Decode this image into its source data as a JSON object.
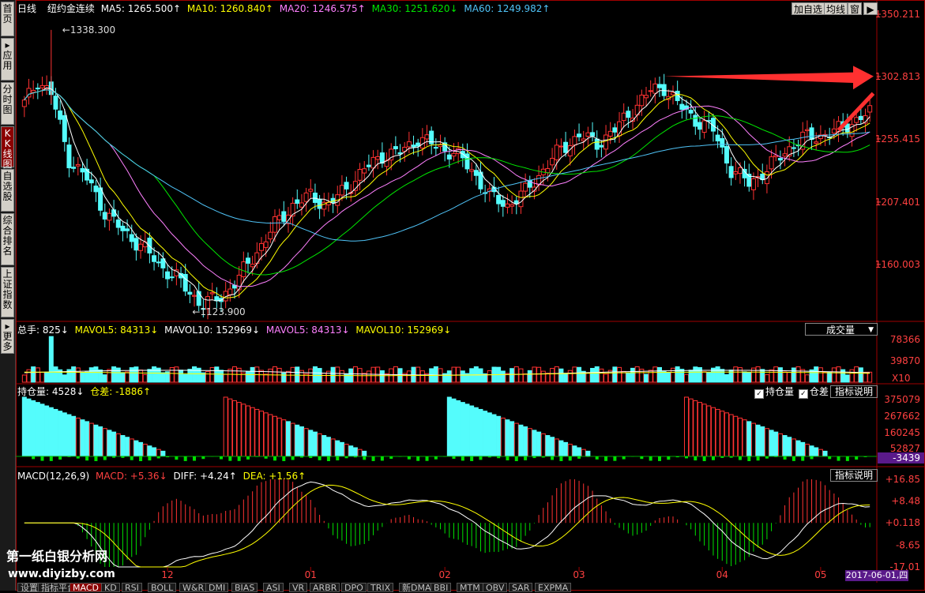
{
  "colors": {
    "up": "#ff3232",
    "down": "#54fcfc",
    "ma5": "#ffffff",
    "ma10": "#ffff00",
    "ma20": "#ff80ff",
    "ma30": "#00e600",
    "ma60": "#4fc3f7",
    "axis": "#ff4040",
    "grid": "#a00000",
    "volMA5": "#ffffff",
    "volMA10": "#ffff00"
  },
  "sidebar": [
    {
      "label": "首页",
      "icon": ""
    },
    {
      "label": "应用",
      "icon": "▸"
    },
    {
      "label": "分时图",
      "icon": ""
    },
    {
      "label": "K线图",
      "icon": "K"
    },
    {
      "label": "自选股",
      "icon": ""
    },
    {
      "label": "综合排名",
      "icon": ""
    },
    {
      "label": "上证指数",
      "icon": ""
    },
    {
      "label": "更多",
      "icon": "▸"
    }
  ],
  "header": {
    "period": "日线",
    "name": "纽约金连续",
    "ma5": "MA5: 1265.500↑",
    "ma10": "MA10: 1260.840↑",
    "ma20": "MA20: 1246.575↑",
    "ma30": "MA30: 1251.620↓",
    "ma60": "MA60: 1249.982↑"
  },
  "toolbar": {
    "add_fav": "加自选",
    "avg_line": "均线",
    "window": "窗",
    "arrow": "▶"
  },
  "price_axis": [
    "1350.211",
    "1302.813",
    "1255.415",
    "1207.401",
    "1160.003"
  ],
  "annotations": {
    "high": "1338.300",
    "low": "1123.900"
  },
  "volume": {
    "total": "总手: 825↓",
    "mavol5": "MAVOL5: 84313↓",
    "mavol10": "MAVOL10: 152969↓",
    "mavol5b": "MAVOL5: 84313↓",
    "mavol10b": "MAVOL10: 152969↓",
    "selector": "成交量",
    "axis": [
      "78366",
      "39870"
    ],
    "unit": "X10"
  },
  "oi": {
    "label": "持仓量: 4528↓",
    "diff": "仓差: -1886↑",
    "chk1": "持仓量",
    "chk2": "仓差",
    "help": "指标说明",
    "axis": [
      "375079",
      "267662",
      "160245",
      "52827"
    ],
    "current": "-3439"
  },
  "macd": {
    "name": "MACD(12,26,9)",
    "macd": "MACD: +5.36↓",
    "diff": "DIFF: +4.24↑",
    "dea": "DEA: +1.56↑",
    "help": "指标说明",
    "axis": [
      "+16.85",
      "+8.48",
      "+0.118",
      "-8.65",
      "-17.01"
    ]
  },
  "watermark": {
    "title": "第一纸白银分析网",
    "url": "www.diyizby.com"
  },
  "months": [
    "12",
    "01",
    "02",
    "03",
    "04",
    "05"
  ],
  "date_badge": "2017-06-01,四",
  "tabs": [
    "设置",
    "指标平台",
    "MACD",
    "KD",
    "RSI",
    "BOLL",
    "W&R",
    "DMI",
    "BIAS",
    "ASI",
    "VR",
    "ARBR",
    "DPO",
    "TRIX",
    "新DMA",
    "BBI",
    "MTM",
    "OBV",
    "SAR",
    "EXPMA"
  ],
  "chart_data": {
    "type": "candlestick",
    "price_ylim": [
      1123.9,
      1350.211
    ],
    "price_ticks": [
      1350.211,
      1302.813,
      1255.415,
      1207.401,
      1160.003
    ],
    "high": 1338.3,
    "low": 1123.9,
    "close_anchors": [
      [
        0,
        1282
      ],
      [
        3,
        1300
      ],
      [
        6,
        1290
      ],
      [
        10,
        1240
      ],
      [
        14,
        1225
      ],
      [
        18,
        1200
      ],
      [
        22,
        1185
      ],
      [
        26,
        1175
      ],
      [
        30,
        1160
      ],
      [
        34,
        1150
      ],
      [
        37,
        1138
      ],
      [
        40,
        1130
      ],
      [
        44,
        1135
      ],
      [
        48,
        1150
      ],
      [
        52,
        1170
      ],
      [
        56,
        1190
      ],
      [
        60,
        1205
      ],
      [
        64,
        1212
      ],
      [
        68,
        1205
      ],
      [
        72,
        1218
      ],
      [
        76,
        1232
      ],
      [
        80,
        1243
      ],
      [
        84,
        1245
      ],
      [
        88,
        1256
      ],
      [
        92,
        1250
      ],
      [
        96,
        1245
      ],
      [
        100,
        1232
      ],
      [
        104,
        1212
      ],
      [
        108,
        1205
      ],
      [
        112,
        1215
      ],
      [
        116,
        1232
      ],
      [
        120,
        1248
      ],
      [
        124,
        1258
      ],
      [
        128,
        1252
      ],
      [
        132,
        1262
      ],
      [
        136,
        1278
      ],
      [
        140,
        1292
      ],
      [
        143,
        1295
      ],
      [
        146,
        1282
      ],
      [
        150,
        1270
      ],
      [
        154,
        1262
      ],
      [
        158,
        1232
      ],
      [
        162,
        1222
      ],
      [
        166,
        1232
      ],
      [
        170,
        1246
      ],
      [
        174,
        1256
      ],
      [
        178,
        1258
      ],
      [
        182,
        1262
      ],
      [
        186,
        1270
      ],
      [
        189,
        1275
      ]
    ],
    "volume_max": 78366,
    "oi_ticks": [
      375079,
      267662,
      160245,
      52827
    ],
    "macd_ticks": [
      16.85,
      8.48,
      0.118,
      -8.65,
      -17.01
    ],
    "months": [
      "12",
      "01",
      "02",
      "03",
      "04",
      "05"
    ]
  }
}
